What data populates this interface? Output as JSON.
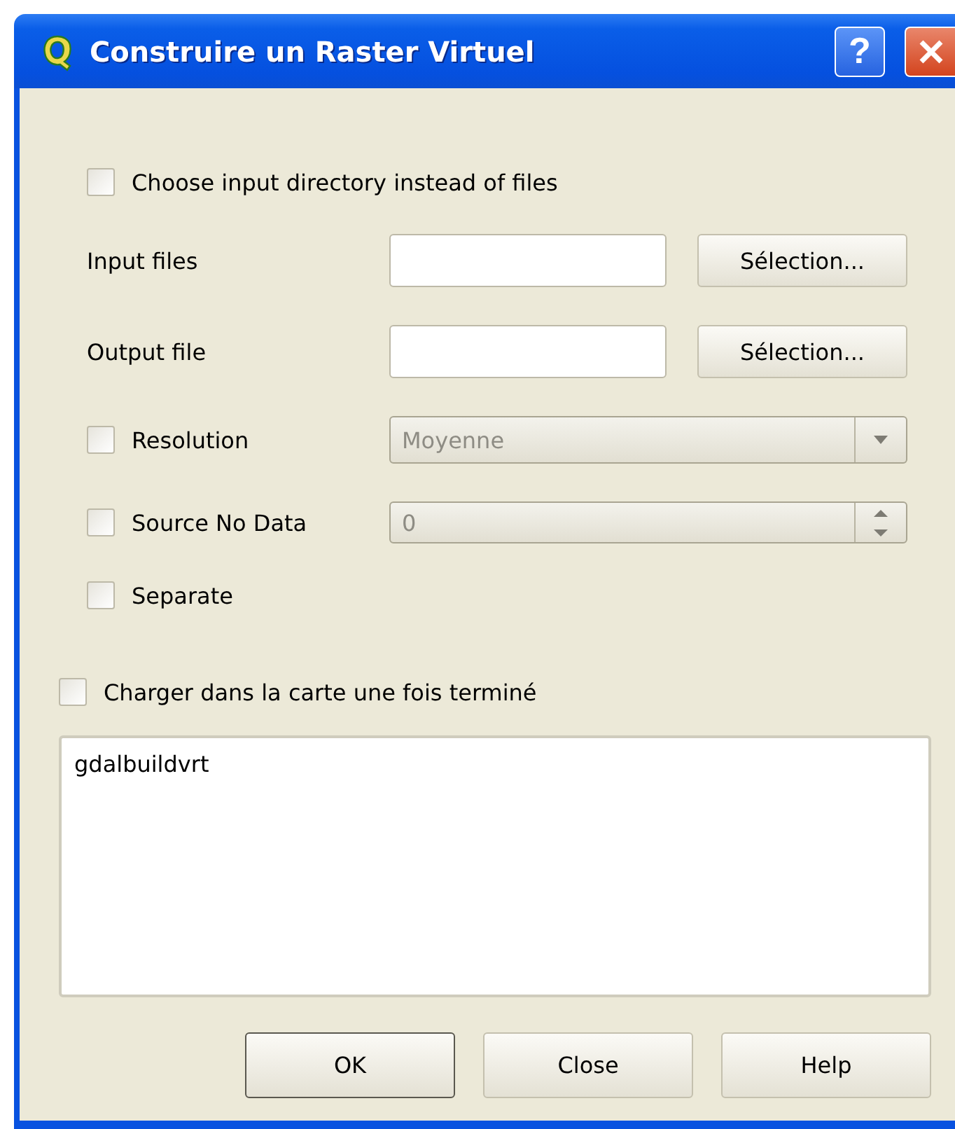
{
  "window": {
    "title": "Construire un Raster Virtuel",
    "help_label": "?"
  },
  "directory_option": {
    "label": "Choose input directory instead of files",
    "checked": false
  },
  "file_rows": [
    {
      "label": "Input files",
      "button": "Sélection..."
    },
    {
      "label": "Output file",
      "button": "Sélection..."
    }
  ],
  "options": [
    {
      "kind": "combo",
      "label": "Resolution",
      "checked": false,
      "value": "Moyenne",
      "disabled": true
    },
    {
      "kind": "spin",
      "label": "Source No Data",
      "checked": false,
      "value": "0",
      "disabled": true
    },
    {
      "kind": "plain",
      "label": "Separate",
      "checked": false
    }
  ],
  "load_option": {
    "label": "Charger dans la carte une fois terminé",
    "checked": false
  },
  "command": {
    "text": "gdalbuildvrt"
  },
  "buttons": [
    {
      "label": "OK",
      "default": true
    },
    {
      "label": "Close",
      "default": false
    },
    {
      "label": "Help",
      "default": false
    }
  ]
}
